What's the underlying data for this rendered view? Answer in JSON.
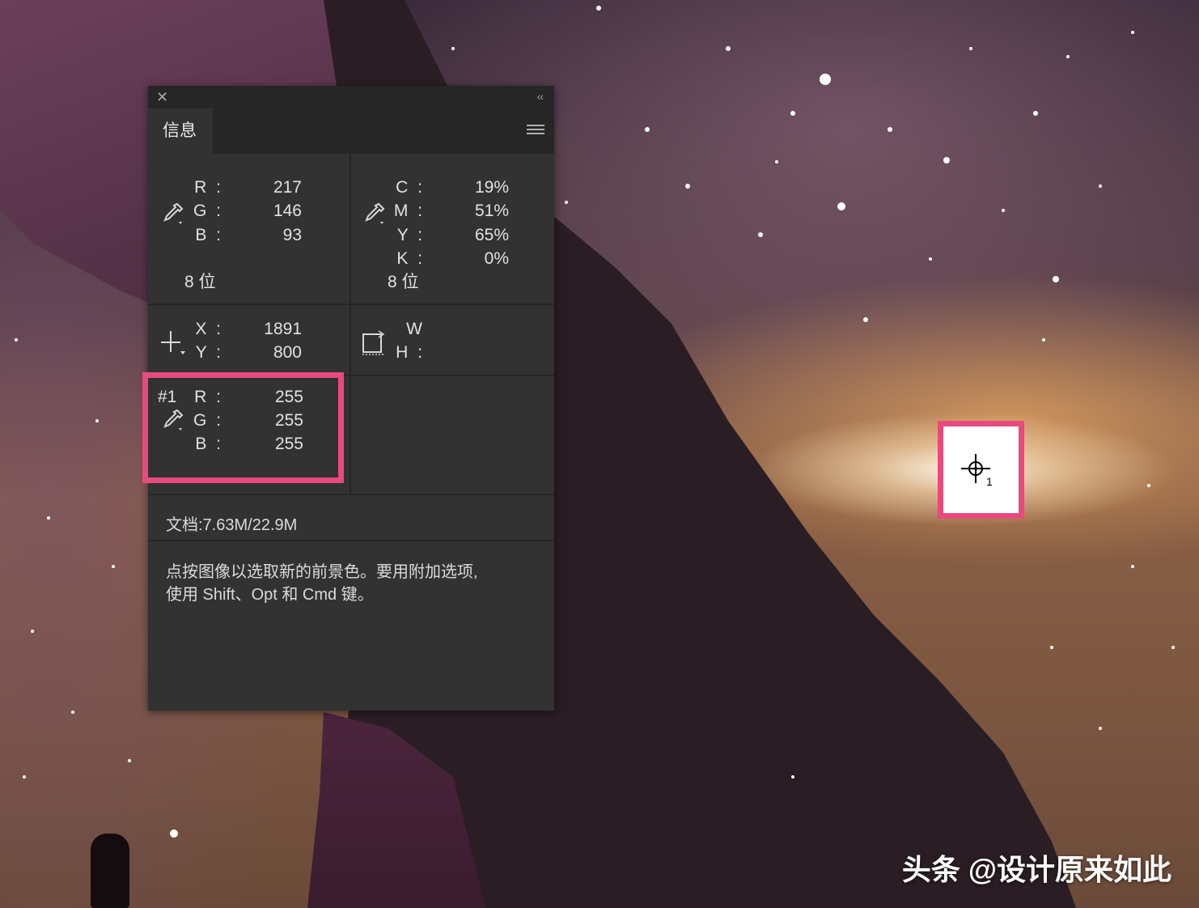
{
  "panel": {
    "tab_label": "信息",
    "rgb": {
      "r_label": "R :",
      "g_label": "G :",
      "b_label": "B :",
      "r": "217",
      "g": "146",
      "b": "93",
      "bits": "8 位"
    },
    "cmyk": {
      "c_label": "C :",
      "m_label": "M :",
      "y_label": "Y :",
      "k_label": "K :",
      "c": "19%",
      "m": "51%",
      "y": "65%",
      "k": "0%",
      "bits": "8 位"
    },
    "position": {
      "x_label": "X :",
      "y_label": "Y :",
      "x": "1891",
      "y": "800"
    },
    "size": {
      "w_label": "W :",
      "h_label": "H :"
    },
    "sampler1": {
      "id": "#1",
      "r_label": "R :",
      "g_label": "G :",
      "b_label": "B :",
      "r": "255",
      "g": "255",
      "b": "255"
    },
    "document": "文档:7.63M/22.9M",
    "hint_line1": "点按图像以选取新的前景色。要用附加选项,",
    "hint_line2": "使用 Shift、Opt 和 Cmd 键。"
  },
  "sampler_marker": {
    "number": "1"
  },
  "watermark": "头条 @设计原来如此",
  "colors": {
    "highlight": "#e84a7f",
    "panel_bg": "#323232",
    "panel_dark": "#262626"
  }
}
